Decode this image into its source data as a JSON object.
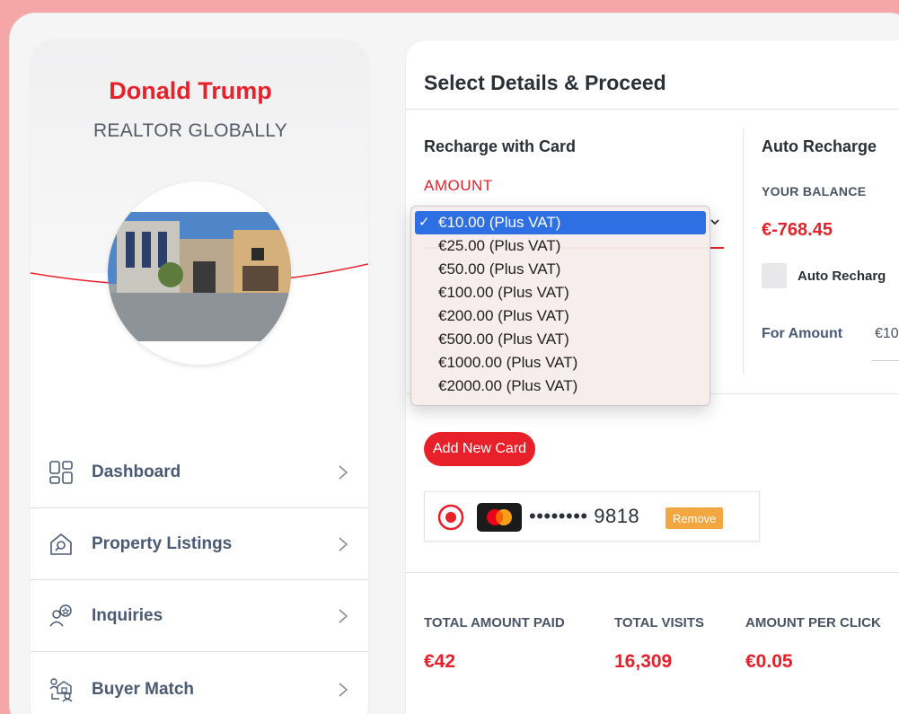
{
  "colors": {
    "accent": "#e8202a",
    "highlight": "#2f6fe4",
    "remove": "#f2a741",
    "background": "#f4a7a6"
  },
  "profile": {
    "name": "Donald Trump",
    "role": "REALTOR GLOBALLY"
  },
  "nav": [
    {
      "label": "Dashboard",
      "icon": "dashboard-grid-icon"
    },
    {
      "label": "Property Listings",
      "icon": "house-search-icon"
    },
    {
      "label": "Inquiries",
      "icon": "users-star-icon"
    },
    {
      "label": "Buyer Match",
      "icon": "buyer-match-icon"
    }
  ],
  "main": {
    "title": "Select Details & Proceed",
    "recharge": {
      "title": "Recharge with Card",
      "amount_label": "AMOUNT",
      "selected": "€10.00 (Plus VAT)",
      "options": [
        "€10.00 (Plus VAT)",
        "€25.00 (Plus VAT)",
        "€50.00 (Plus VAT)",
        "€100.00 (Plus VAT)",
        "€200.00 (Plus VAT)",
        "€500.00 (Plus VAT)",
        "€1000.00 (Plus VAT)",
        "€2000.00 (Plus VAT)"
      ]
    },
    "auto": {
      "title": "Auto Recharge",
      "balance_label": "YOUR BALANCE",
      "balance_value": "€-768.45",
      "checkbox_label": "Auto Recharg",
      "for_amount_label": "For Amount",
      "for_amount_value": "€10"
    },
    "card": {
      "add_label": "Add New Card",
      "number": "•••••••• 9818",
      "remove_label": "Remove"
    },
    "stats": [
      {
        "label": "TOTAL AMOUNT PAID",
        "value": "€42"
      },
      {
        "label": "TOTAL VISITS",
        "value": "16,309"
      },
      {
        "label": "AMOUNT PER CLICK",
        "value": "€0.05"
      }
    ]
  }
}
